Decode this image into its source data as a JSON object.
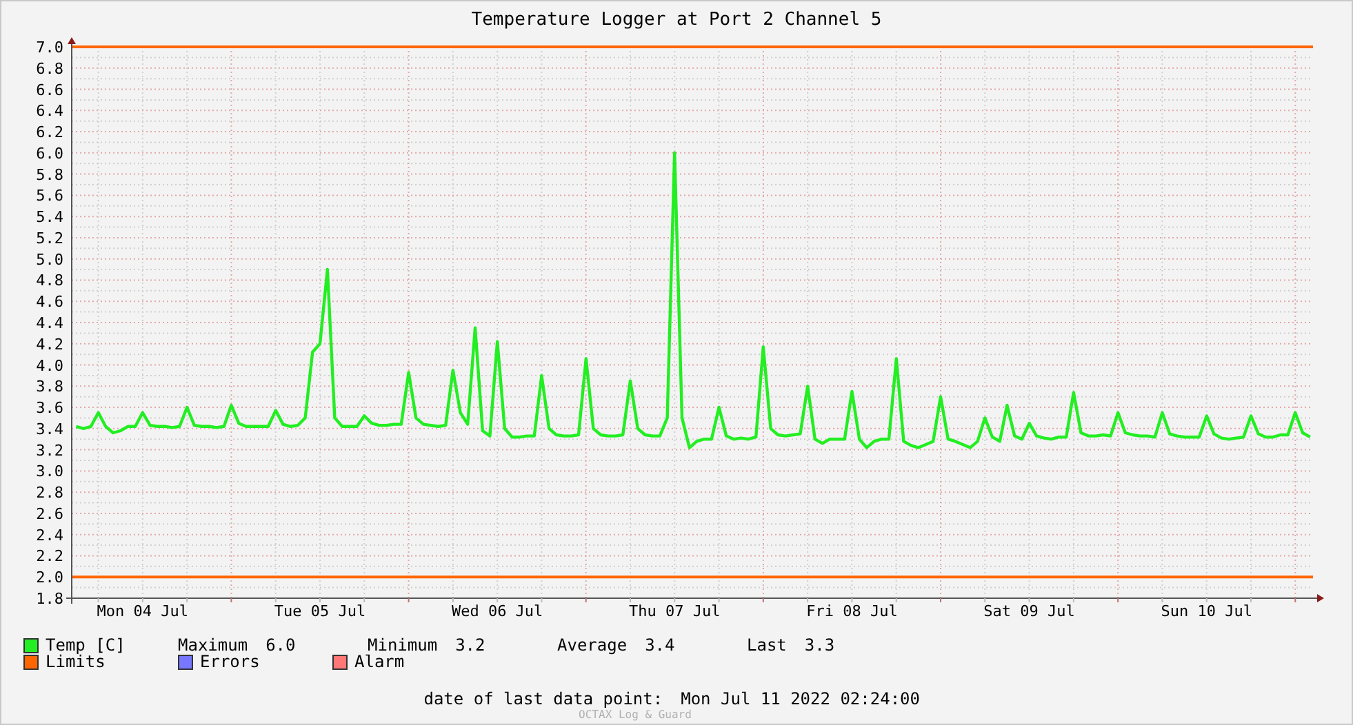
{
  "title": "Temperature Logger at Port 2 Channel 5",
  "chart": {
    "chart_data": {
      "type": "line",
      "ylim": [
        1.8,
        7.0
      ],
      "grid": true,
      "yticks": [
        {
          "value": 1.8,
          "label": "1.8"
        },
        {
          "value": 2.0,
          "label": "2.0"
        },
        {
          "value": 2.2,
          "label": "2.2"
        },
        {
          "value": 2.4,
          "label": "2.4"
        },
        {
          "value": 2.6,
          "label": "2.6"
        },
        {
          "value": 2.8,
          "label": "2.8"
        },
        {
          "value": 3.0,
          "label": "3.0"
        },
        {
          "value": 3.2,
          "label": "3.2"
        },
        {
          "value": 3.4,
          "label": "3.4"
        },
        {
          "value": 3.6,
          "label": "3.6"
        },
        {
          "value": 3.8,
          "label": "3.8"
        },
        {
          "value": 4.0,
          "label": "4.0"
        },
        {
          "value": 4.2,
          "label": "4.2"
        },
        {
          "value": 4.4,
          "label": "4.4"
        },
        {
          "value": 4.6,
          "label": "4.6"
        },
        {
          "value": 4.8,
          "label": "4.8"
        },
        {
          "value": 5.0,
          "label": "5.0"
        },
        {
          "value": 5.2,
          "label": "5.2"
        },
        {
          "value": 5.4,
          "label": "5.4"
        },
        {
          "value": 5.6,
          "label": "5.6"
        },
        {
          "value": 5.8,
          "label": "5.8"
        },
        {
          "value": 6.0,
          "label": "6.0"
        },
        {
          "value": 6.2,
          "label": "6.2"
        },
        {
          "value": 6.4,
          "label": "6.4"
        },
        {
          "value": 6.6,
          "label": "6.6"
        },
        {
          "value": 6.8,
          "label": "6.8"
        },
        {
          "value": 7.0,
          "label": "7.0"
        }
      ],
      "categories": [
        null,
        null,
        null,
        null,
        null,
        null,
        null,
        null,
        null,
        "Mon 04 Jul",
        null,
        null,
        null,
        null,
        null,
        null,
        null,
        null,
        null,
        null,
        null,
        null,
        null,
        null,
        null,
        null,
        null,
        null,
        null,
        null,
        null,
        null,
        null,
        "Tue 05 Jul",
        null,
        null,
        null,
        null,
        null,
        null,
        null,
        null,
        null,
        null,
        null,
        null,
        null,
        null,
        null,
        null,
        null,
        null,
        null,
        null,
        null,
        null,
        null,
        "Wed 06 Jul",
        null,
        null,
        null,
        null,
        null,
        null,
        null,
        null,
        null,
        null,
        null,
        null,
        null,
        null,
        null,
        null,
        null,
        null,
        null,
        null,
        null,
        null,
        null,
        "Thu 07 Jul",
        null,
        null,
        null,
        null,
        null,
        null,
        null,
        null,
        null,
        null,
        null,
        null,
        null,
        null,
        null,
        null,
        null,
        null,
        null,
        null,
        null,
        null,
        null,
        "Fri 08 Jul",
        null,
        null,
        null,
        null,
        null,
        null,
        null,
        null,
        null,
        null,
        null,
        null,
        null,
        null,
        null,
        null,
        null,
        null,
        null,
        null,
        null,
        null,
        null,
        "Sat 09 Jul",
        null,
        null,
        null,
        null,
        null,
        null,
        null,
        null,
        null,
        null,
        null,
        null,
        null,
        null,
        null,
        null,
        null,
        null,
        null,
        null,
        null,
        null,
        null,
        "Sun 10 Jul",
        null,
        null,
        null,
        null,
        null,
        null,
        null,
        null,
        null,
        null,
        null,
        null,
        null,
        null
      ],
      "series": [
        {
          "name": "Temp [C]",
          "color": "#22ee22",
          "values": [
            3.42,
            3.4,
            3.42,
            3.55,
            3.42,
            3.36,
            3.38,
            3.42,
            3.42,
            3.55,
            3.43,
            3.42,
            3.42,
            3.41,
            3.42,
            3.6,
            3.43,
            3.42,
            3.42,
            3.41,
            3.42,
            3.62,
            3.45,
            3.42,
            3.42,
            3.42,
            3.42,
            3.57,
            3.44,
            3.42,
            3.43,
            3.5,
            4.12,
            4.2,
            4.9,
            3.5,
            3.42,
            3.42,
            3.42,
            3.52,
            3.45,
            3.43,
            3.43,
            3.44,
            3.44,
            3.93,
            3.5,
            3.44,
            3.43,
            3.42,
            3.43,
            3.95,
            3.55,
            3.44,
            4.35,
            3.38,
            3.33,
            4.22,
            3.4,
            3.32,
            3.32,
            3.33,
            3.33,
            3.9,
            3.4,
            3.34,
            3.33,
            3.33,
            3.34,
            4.06,
            3.4,
            3.34,
            3.33,
            3.33,
            3.34,
            3.85,
            3.4,
            3.34,
            3.33,
            3.33,
            3.5,
            6.0,
            3.5,
            3.22,
            3.28,
            3.3,
            3.3,
            3.6,
            3.33,
            3.3,
            3.31,
            3.3,
            3.32,
            4.17,
            3.4,
            3.34,
            3.33,
            3.34,
            3.35,
            3.8,
            3.3,
            3.26,
            3.3,
            3.3,
            3.3,
            3.75,
            3.3,
            3.22,
            3.28,
            3.3,
            3.3,
            4.06,
            3.28,
            3.24,
            3.22,
            3.25,
            3.28,
            3.7,
            3.3,
            3.28,
            3.25,
            3.22,
            3.28,
            3.5,
            3.32,
            3.28,
            3.62,
            3.33,
            3.3,
            3.45,
            3.33,
            3.31,
            3.3,
            3.32,
            3.32,
            3.74,
            3.36,
            3.33,
            3.33,
            3.34,
            3.33,
            3.55,
            3.36,
            3.34,
            3.33,
            3.33,
            3.32,
            3.55,
            3.35,
            3.33,
            3.32,
            3.32,
            3.32,
            3.52,
            3.35,
            3.31,
            3.3,
            3.31,
            3.32,
            3.52,
            3.35,
            3.32,
            3.32,
            3.34,
            3.34,
            3.55,
            3.36,
            3.32
          ]
        }
      ],
      "ref_lines": [
        {
          "axis": "y",
          "value": 7.0
        },
        {
          "axis": "y",
          "value": 2.0
        }
      ]
    }
  },
  "legend": {
    "series": [
      {
        "label": "Limits",
        "color": "#ff6600"
      },
      {
        "label": "Errors",
        "color": "#7777ff"
      },
      {
        "label": "Alarm",
        "color": "#ff7777"
      }
    ],
    "stats": [
      {
        "label": "Maximum",
        "value": "6.0"
      },
      {
        "label": "Minimum",
        "value": "3.2"
      },
      {
        "label": "Average",
        "value": "3.4"
      },
      {
        "label": "Last",
        "value": "3.3"
      }
    ]
  },
  "footer": {
    "label": "date of last data point:",
    "value": "Mon Jul 11 2022 02:24:00"
  },
  "watermark": "OCTAX Log & Guard"
}
